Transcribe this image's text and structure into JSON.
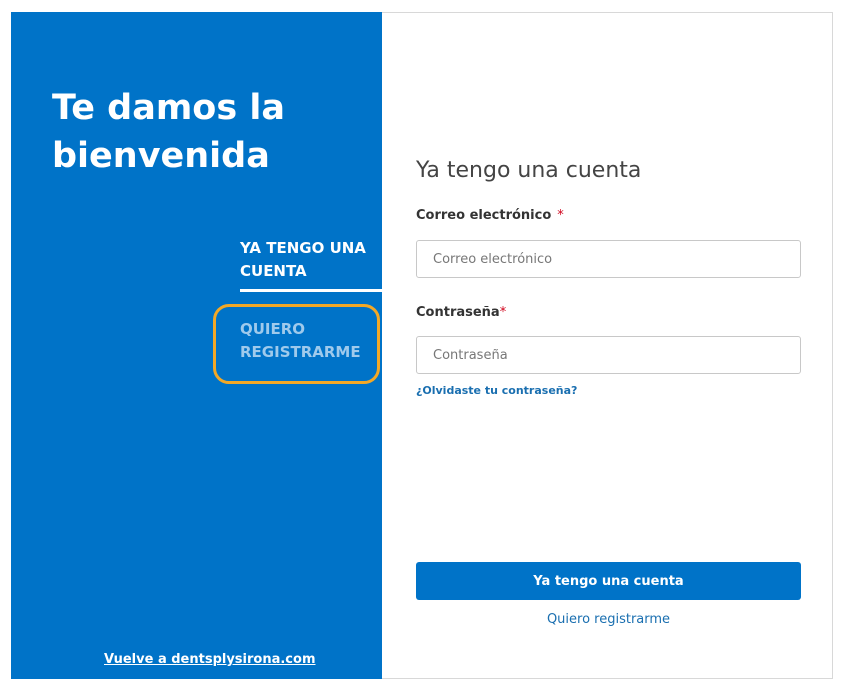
{
  "welcome": {
    "heading": "Te damos la bienvenida"
  },
  "nav": {
    "tabs": [
      {
        "label": "YA TENGO UNA CUENTA",
        "active": true
      },
      {
        "label": "QUIERO REGISTRARME",
        "active": false
      }
    ],
    "highlight_color": "#f3a826"
  },
  "footer": {
    "back_link": "Vuelve a dentsplysirona.com"
  },
  "form": {
    "title": "Ya tengo una cuenta",
    "email": {
      "label": "Correo electrónico",
      "required_mark": "*",
      "placeholder": "Correo electrónico",
      "value": ""
    },
    "password": {
      "label": "Contraseña",
      "required_mark": "*",
      "placeholder": "Contraseña",
      "value": ""
    },
    "forgot_link": "¿Olvidaste tu contraseña?",
    "submit_label": "Ya tengo una cuenta",
    "register_link": "Quiero registrarme"
  },
  "colors": {
    "brand_blue": "#0073c8",
    "link_blue": "#1a6fb0",
    "required_red": "#d0021b"
  }
}
